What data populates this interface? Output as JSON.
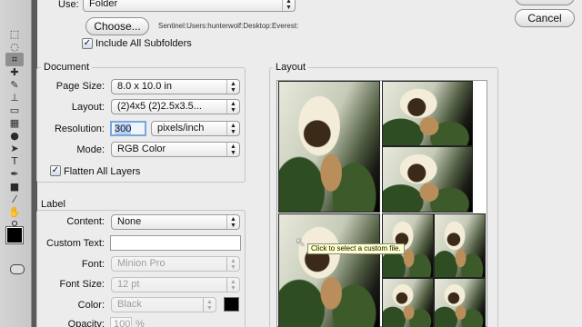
{
  "tools": [
    {
      "icon": "marquee-icon",
      "glyph": "⬚"
    },
    {
      "icon": "lasso-icon",
      "glyph": "◌"
    },
    {
      "icon": "crop-icon",
      "glyph": "⌗"
    },
    {
      "icon": "healing-brush-icon",
      "glyph": "✚"
    },
    {
      "icon": "brush-icon",
      "glyph": "✎"
    },
    {
      "icon": "clone-stamp-icon",
      "glyph": "⊥"
    },
    {
      "icon": "eraser-icon",
      "glyph": "▭"
    },
    {
      "icon": "gradient-icon",
      "glyph": "▦"
    },
    {
      "icon": "dodge-icon",
      "glyph": "●"
    },
    {
      "icon": "path-select-icon",
      "glyph": "➤"
    },
    {
      "icon": "type-icon",
      "glyph": "T"
    },
    {
      "icon": "pen-icon",
      "glyph": "✒"
    },
    {
      "icon": "shape-icon",
      "glyph": "■"
    },
    {
      "icon": "eyedropper-icon",
      "glyph": "⁄"
    },
    {
      "icon": "hand-icon",
      "glyph": "✋"
    },
    {
      "icon": "zoom-icon",
      "glyph": "⚲"
    }
  ],
  "source": {
    "use_label": "Use:",
    "use_value": "Folder",
    "choose_button": "Choose...",
    "path": "Sentinel:Users:hunterwolf:Desktop:Everest:",
    "include_subfolders_label": "Include All Subfolders",
    "include_subfolders_checked": true
  },
  "buttons": {
    "cancel": "Cancel"
  },
  "document": {
    "title": "Document",
    "page_size_label": "Page Size:",
    "page_size_value": "8.0 x 10.0 in",
    "layout_label": "Layout:",
    "layout_value": "(2)4x5 (2)2.5x3.5...",
    "resolution_label": "Resolution:",
    "resolution_value": "300",
    "resolution_unit": "pixels/inch",
    "mode_label": "Mode:",
    "mode_value": "RGB Color",
    "flatten_label": "Flatten All Layers",
    "flatten_checked": true
  },
  "label": {
    "title": "Label",
    "content_label": "Content:",
    "content_value": "None",
    "custom_text_label": "Custom Text:",
    "custom_text_value": "",
    "font_label": "Font:",
    "font_value": "Minion Pro",
    "font_size_label": "Font Size:",
    "font_size_value": "12 pt",
    "color_label": "Color:",
    "color_value": "Black",
    "swatch_color": "#000000",
    "opacity_label": "Opacity:",
    "opacity_value": "100",
    "opacity_unit": "%"
  },
  "layout_preview": {
    "title": "Layout",
    "tooltip": "Click to select a custom file."
  }
}
